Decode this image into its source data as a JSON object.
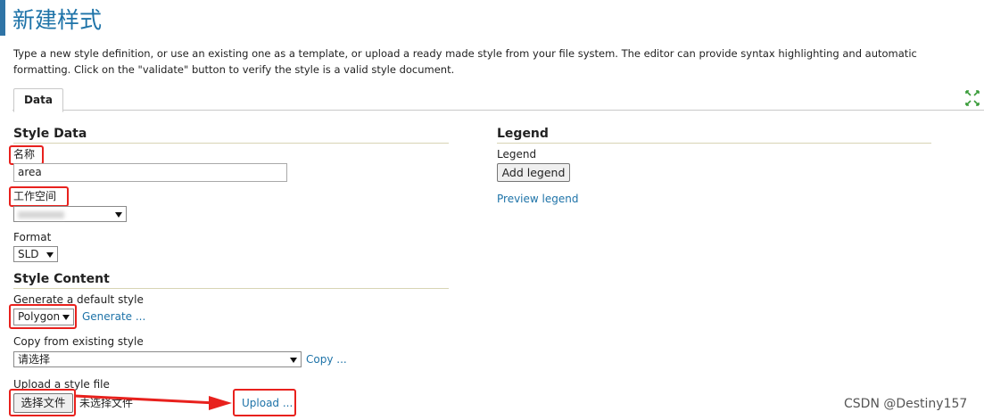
{
  "page": {
    "title": "新建样式",
    "intro": "Type a new style definition, or use an existing one as a template, or upload a ready made style from your file system. The editor can provide syntax highlighting and automatic formatting. Click on the \"validate\" button to verify the style is a valid style document."
  },
  "tabs": [
    {
      "label": "Data"
    }
  ],
  "style_data": {
    "heading": "Style Data",
    "name_label": "名称",
    "name_value": "area",
    "workspace_label": "工作空间",
    "format_label": "Format",
    "format_value": "SLD"
  },
  "style_content": {
    "heading": "Style Content",
    "generate_label": "Generate a default style",
    "generate_value": "Polygon",
    "generate_link": "Generate ...",
    "copy_label": "Copy from existing style",
    "copy_value": "请选择",
    "copy_link": "Copy ...",
    "upload_label": "Upload a style file",
    "choose_file_button": "选择文件",
    "no_file_text": "未选择文件",
    "upload_link": "Upload ..."
  },
  "legend": {
    "heading": "Legend",
    "label": "Legend",
    "add_button": "Add legend",
    "preview_link": "Preview legend"
  },
  "watermark": "CSDN @Destiny157",
  "colors": {
    "title_blue": "#1e73a8",
    "link_blue": "#1e73a8",
    "annotation_red": "#e8211d",
    "section_rule": "#d8d4b4"
  },
  "icons": [
    "expand-icon",
    "dropdown-caret-icon",
    "arrow-annotation"
  ]
}
